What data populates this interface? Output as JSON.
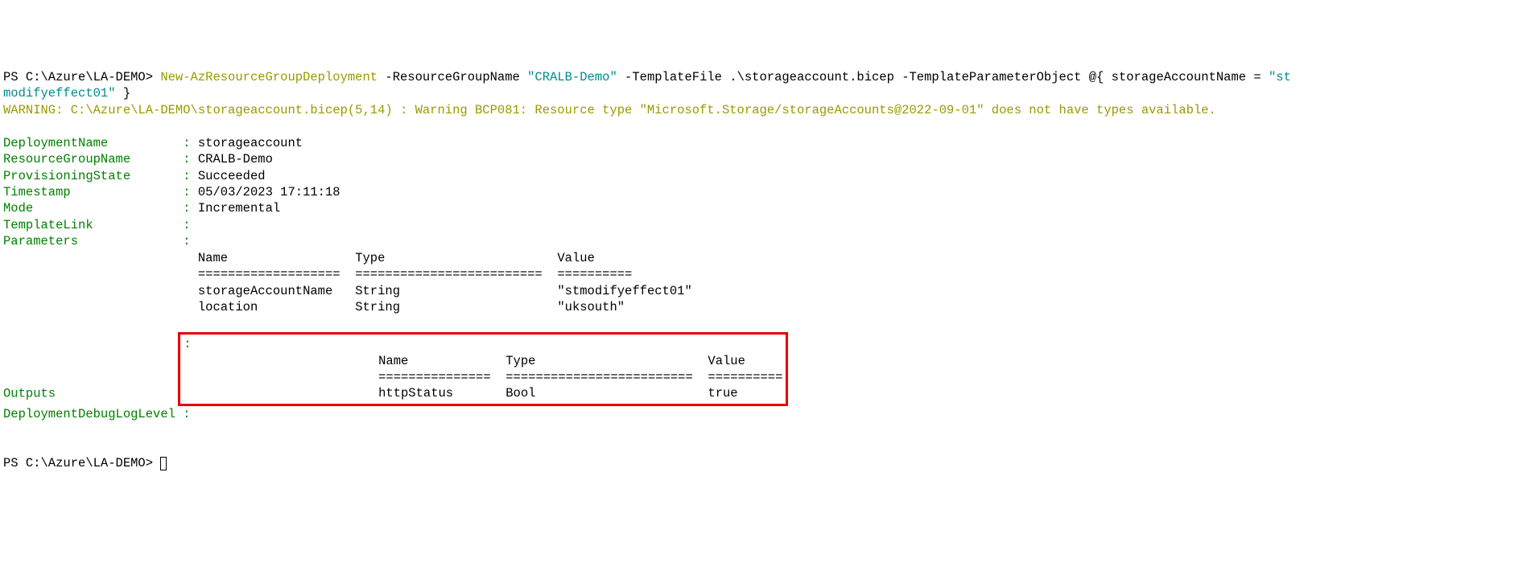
{
  "prompt1": {
    "path": "PS C:\\Azure\\LA-DEMO> ",
    "cmdlet": "New-AzResourceGroupDeployment",
    "argRG": " -ResourceGroupName ",
    "valRG": "\"CRALB-Demo\"",
    "argTF": " -TemplateFile .\\storageaccount.bicep -TemplateParameterObject @{ storageAccountName = ",
    "valSA1": "\"st",
    "valSA2": "modifyeffect01\"",
    "close": " }"
  },
  "warning": "WARNING: C:\\Azure\\LA-DEMO\\storageaccount.bicep(5,14) : Warning BCP081: Resource type \"Microsoft.Storage/storageAccounts@2022-09-01\" does not have types available.",
  "props": {
    "DeploymentName": "storageaccount",
    "ResourceGroupName": "CRALB-Demo",
    "ProvisioningState": "Succeeded",
    "Timestamp": "05/03/2023 17:11:18",
    "Mode": "Incremental",
    "TemplateLink": "",
    "Parameters": ""
  },
  "paramTable": {
    "headers": {
      "name": "Name",
      "type": "Type",
      "value": "Value"
    },
    "rules": {
      "name": "===================",
      "type": "=========================",
      "value": "=========="
    },
    "rows": [
      {
        "name": "storageAccountName",
        "type": "String",
        "value": "\"stmodifyeffect01\""
      },
      {
        "name": "location",
        "type": "String",
        "value": "\"uksouth\""
      }
    ]
  },
  "outputsLabel": "Outputs",
  "outputTable": {
    "headers": {
      "name": "Name",
      "type": "Type",
      "value": "Value"
    },
    "rules": {
      "name": "===============",
      "type": "=========================",
      "value": "=========="
    },
    "rows": [
      {
        "name": "httpStatus",
        "type": "Bool",
        "value": "true"
      }
    ]
  },
  "debugLabel": "DeploymentDebugLogLevel",
  "prompt2": "PS C:\\Azure\\LA-DEMO> "
}
